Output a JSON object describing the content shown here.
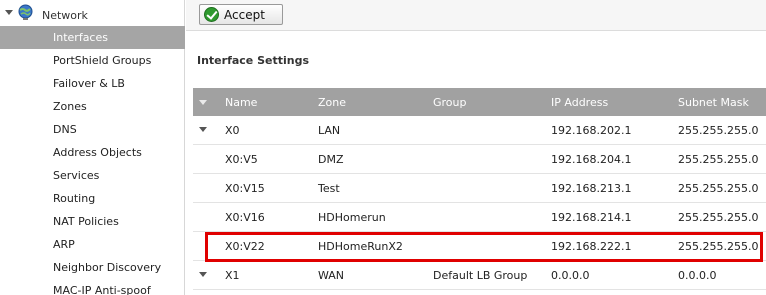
{
  "sidebar": {
    "header_label": "Network",
    "items": [
      {
        "label": "Interfaces",
        "active": true
      },
      {
        "label": "PortShield Groups",
        "active": false
      },
      {
        "label": "Failover & LB",
        "active": false
      },
      {
        "label": "Zones",
        "active": false
      },
      {
        "label": "DNS",
        "active": false
      },
      {
        "label": "Address Objects",
        "active": false
      },
      {
        "label": "Services",
        "active": false
      },
      {
        "label": "Routing",
        "active": false
      },
      {
        "label": "NAT Policies",
        "active": false
      },
      {
        "label": "ARP",
        "active": false
      },
      {
        "label": "Neighbor Discovery",
        "active": false
      },
      {
        "label": "MAC-IP Anti-spoof",
        "active": false
      }
    ]
  },
  "toolbar": {
    "accept_label": "Accept"
  },
  "section": {
    "title": "Interface Settings"
  },
  "table": {
    "headers": {
      "name": "Name",
      "zone": "Zone",
      "group": "Group",
      "ip": "IP Address",
      "mask": "Subnet Mask"
    },
    "rows": [
      {
        "name": "X0",
        "zone": "LAN",
        "group": "",
        "ip": "192.168.202.1",
        "mask": "255.255.255.0",
        "expandable": true
      },
      {
        "name": "X0:V5",
        "zone": "DMZ",
        "group": "",
        "ip": "192.168.204.1",
        "mask": "255.255.255.0",
        "expandable": false
      },
      {
        "name": "X0:V15",
        "zone": "Test",
        "group": "",
        "ip": "192.168.213.1",
        "mask": "255.255.255.0",
        "expandable": false
      },
      {
        "name": "X0:V16",
        "zone": "HDHomerun",
        "group": "",
        "ip": "192.168.214.1",
        "mask": "255.255.255.0",
        "expandable": false
      },
      {
        "name": "X0:V22",
        "zone": "HDHomeRunX2",
        "group": "",
        "ip": "192.168.222.1",
        "mask": "255.255.255.0",
        "expandable": false
      },
      {
        "name": "X1",
        "zone": "WAN",
        "group": "Default LB Group",
        "ip": "0.0.0.0",
        "mask": "0.0.0.0",
        "expandable": true
      }
    ]
  },
  "colors": {
    "highlight": "#e00000",
    "active_item_bg": "#a5a5a5",
    "header_bg": "#a1a1a1",
    "accept_check": "#2e9a2e"
  },
  "icons": {
    "network": "globe-icon",
    "accept": "check-circle-icon"
  }
}
